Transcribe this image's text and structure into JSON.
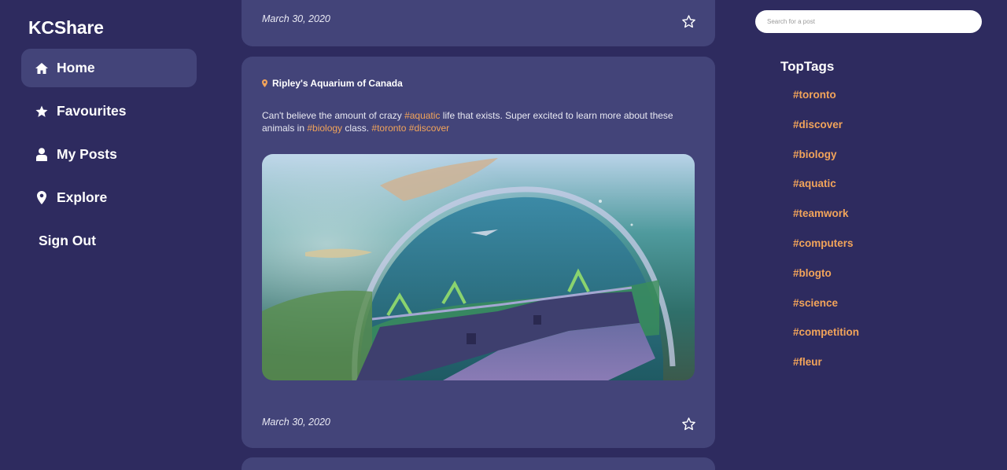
{
  "app": {
    "brand": "KCShare"
  },
  "sidebar": {
    "items": [
      {
        "label": "Home",
        "icon": "home-icon",
        "active": true
      },
      {
        "label": "Favourites",
        "icon": "star-icon"
      },
      {
        "label": "My Posts",
        "icon": "user-icon"
      },
      {
        "label": "Explore",
        "icon": "map-pin-icon"
      },
      {
        "label": "Sign Out"
      }
    ]
  },
  "feed": {
    "prev_post": {
      "date": "March 30, 2020"
    },
    "post": {
      "location": "Ripley's Aquarium of Canada",
      "text_parts": [
        "Can't believe the amount of crazy ",
        "#aquatic",
        " life that exists. Super excited to learn more about these animals in ",
        "#biology",
        " class. ",
        "#toronto",
        " ",
        "#discover"
      ],
      "date": "March 30, 2020",
      "image": "aquarium tunnel photo"
    }
  },
  "search": {
    "placeholder": "Search for a post"
  },
  "top_tags": {
    "title": "TopTags",
    "tags": [
      "#toronto",
      "#discover",
      "#biology",
      "#aquatic",
      "#teamwork",
      "#computers",
      "#blogto",
      "#science",
      "#competition",
      "#fleur"
    ]
  },
  "colors": {
    "background": "#2e2b5f",
    "card": "#434479",
    "accent": "#f2a45a",
    "text": "#ffffff"
  }
}
